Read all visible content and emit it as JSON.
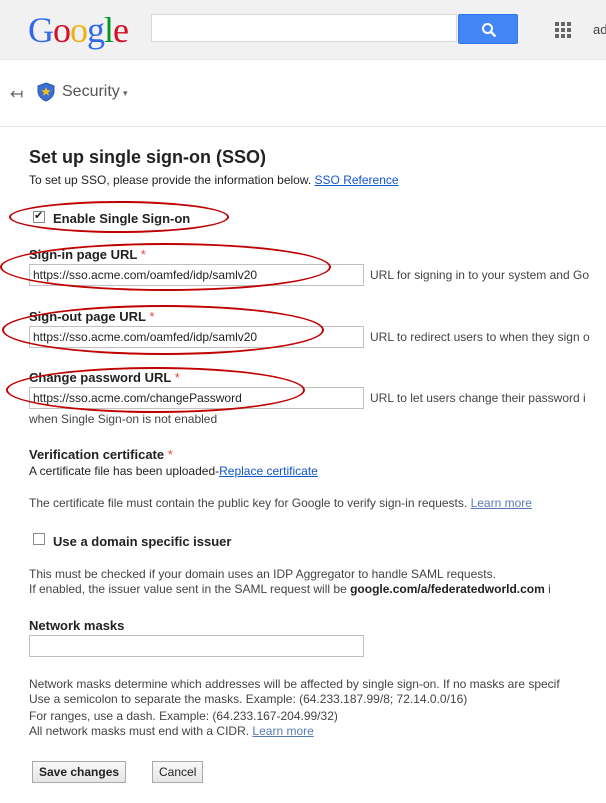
{
  "header": {
    "logo": [
      "G",
      "o",
      "o",
      "g",
      "l",
      "e"
    ],
    "search_placeholder": "",
    "account": "ad"
  },
  "breadcrumb": {
    "back": "↤",
    "section": "Security",
    "caret": "▾"
  },
  "sso": {
    "title": "Set up single sign-on (SSO)",
    "intro": "To set up SSO, please provide the information below.",
    "reference_link": "SSO Reference",
    "enable_label": "Enable Single Sign-on",
    "enable_checked": true,
    "signin": {
      "label": "Sign-in page URL",
      "required": "*",
      "value": "https://sso.acme.com/oamfed/idp/samlv20",
      "hint": "URL for signing in to your system and Go"
    },
    "signout": {
      "label": "Sign-out page URL",
      "required": "*",
      "value": "https://sso.acme.com/oamfed/idp/samlv20",
      "hint": "URL to redirect users to when they sign o"
    },
    "change_password": {
      "label": "Change password URL",
      "required": "*",
      "value": "https://sso.acme.com/changePassword",
      "hint": "URL to let users change their password i",
      "hint_line2": "when Single Sign-on is not enabled"
    },
    "certificate": {
      "label": "Verification certificate",
      "required": "*",
      "status": "A certificate file has been uploaded-",
      "replace_link": "Replace certificate",
      "note": "The certificate file must contain the public key for Google to verify sign-in requests.",
      "learn_more": "Learn more"
    },
    "issuer": {
      "label": "Use a domain specific issuer",
      "checked": false,
      "line1": "This must be checked if your domain uses an IDP Aggregator to handle SAML requests.",
      "line2_prefix": "If enabled, the issuer value sent in the SAML request will be",
      "line2_bold": "google.com/a/federatedworld.com",
      "line2_suffix": "i"
    },
    "network_masks": {
      "label": "Network masks",
      "value": "",
      "line1": "Network masks determine which addresses will be affected by single sign-on. If no masks are specif",
      "line2": "Use a semicolon to separate the masks. Example: (64.233.187.99/8; 72.14.0.0/16)",
      "line3": "For ranges, use a dash. Example: (64.233.167-204.99/32)",
      "line4": "All network masks must end with a CIDR.",
      "learn_more": "Learn more"
    },
    "buttons": {
      "save": "Save changes",
      "cancel": "Cancel"
    }
  },
  "colors": {
    "annotation": "#c00000",
    "link": "#1155cc",
    "search_button": "#4285f4"
  }
}
